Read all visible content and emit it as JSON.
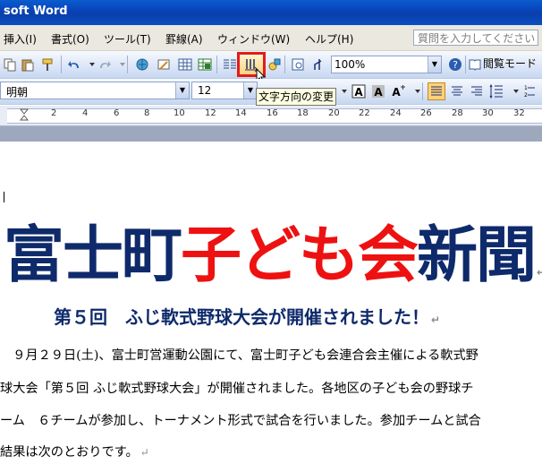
{
  "window": {
    "title": "soft Word"
  },
  "menubar": {
    "items": [
      "挿入(I)",
      "書式(O)",
      "ツール(T)",
      "罫線(A)",
      "ウィンドウ(W)",
      "ヘルプ(H)"
    ],
    "help_placeholder": "質問を入力してください"
  },
  "toolbar": {
    "zoom": "100%",
    "read_mode_label": "閲覧モード",
    "icons": [
      "copy-icon",
      "paste-icon",
      "format-painter-icon",
      "undo-icon",
      "redo-icon",
      "hyperlink-icon",
      "tables-borders-icon",
      "insert-table-icon",
      "insert-excel-icon",
      "columns-icon",
      "text-direction-icon",
      "drawing-icon",
      "document-map-icon",
      "show-hide-icon",
      "help-icon",
      "read-mode-icon"
    ]
  },
  "formatting": {
    "font": "明朝",
    "size": "12",
    "icons": [
      "bold-icon",
      "char-border-icon",
      "char-shading-icon",
      "char-scale-icon",
      "align-left-icon",
      "align-center-icon",
      "align-right-icon",
      "line-spacing-icon",
      "numbering-icon"
    ]
  },
  "tooltip": {
    "text": "文字方向の変更"
  },
  "ruler": {
    "numbers": [
      "2",
      "4",
      "6",
      "8",
      "10",
      "12",
      "14",
      "16",
      "18",
      "20",
      "22",
      "24",
      "26",
      "28",
      "30",
      "32"
    ]
  },
  "document": {
    "headline": {
      "part1": "富士町",
      "part2": "子ども会",
      "part3": "新聞"
    },
    "subheading": "第５回　ふじ軟式野球大会が開催されました！",
    "paragraph_lines": [
      "　９月２９日(土)、富士町営運動公園にて、富士町子ども会連合会主催による軟式野",
      "球大会「第５回 ふじ軟式野球大会」が開催されました。各地区の子ども会の野球チ",
      "ーム　６チームが参加し、トーナメント形式で試合を行いました。参加チームと試合",
      "結果は次のとおりです。"
    ],
    "paragraph_mark": "↵"
  },
  "colors": {
    "headline_navy": "#0e2a6b",
    "headline_red": "#ee1111",
    "highlight": "#e21b1b"
  }
}
